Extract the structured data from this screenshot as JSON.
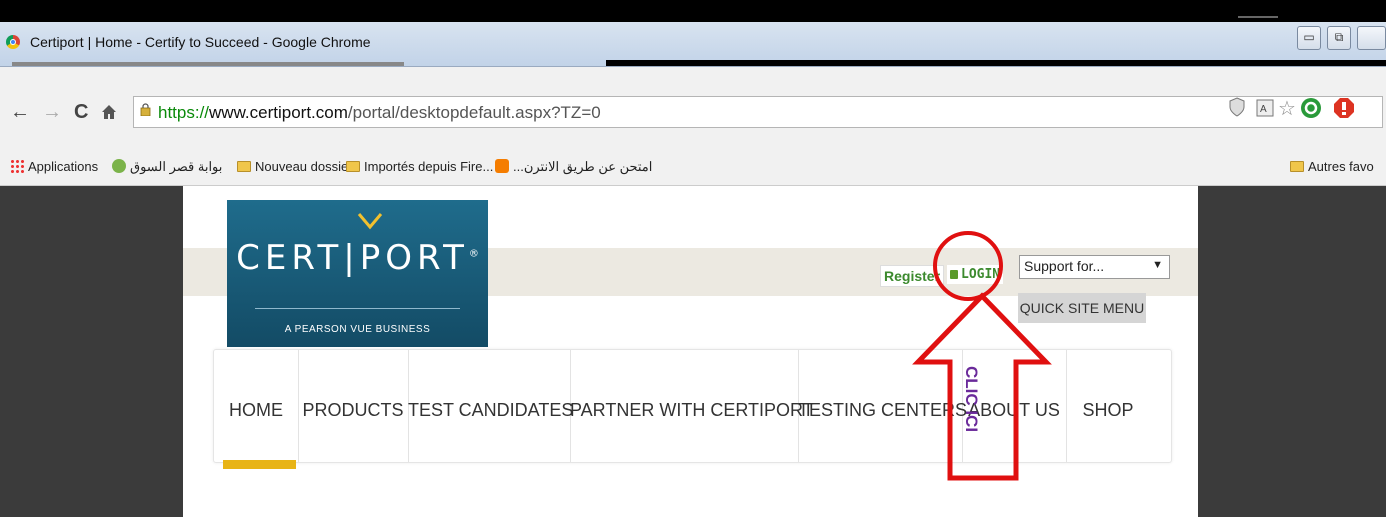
{
  "window": {
    "title": "Certiport | Home - Certify to Succeed - Google Chrome",
    "controls": {
      "minimize": "▭",
      "restore": "⧉"
    }
  },
  "navbar": {
    "url": {
      "scheme": "https://",
      "host": "www.certiport.com",
      "path": "/portal/desktopdefault.aspx?TZ=0"
    },
    "back": "←",
    "forward": "→",
    "reload": "C",
    "home": "🏠"
  },
  "bookmarks": {
    "items": [
      {
        "label": "Applications",
        "icon": "apps-icon"
      },
      {
        "label": "بوابة قصر السوق",
        "icon": "site-icon"
      },
      {
        "label": "Nouveau dossier",
        "icon": "folder-icon"
      },
      {
        "label": "Importés depuis Fire...",
        "icon": "folder-icon"
      },
      {
        "label": "امتحن عن طريق الانترن...",
        "icon": "blogger-icon"
      }
    ],
    "other": {
      "label": "Autres favo",
      "icon": "folder-icon"
    }
  },
  "site": {
    "logo": {
      "name": "CERT|PORT",
      "registered": "®",
      "tagline": "A PEARSON VUE BUSINESS"
    },
    "register": "Register",
    "login": "LOGIN",
    "support_select": {
      "selected": "Support for..."
    },
    "quick_menu": "QUICK SITE MENU",
    "nav": [
      "HOME",
      "PRODUCTS",
      "TEST CANDIDATES",
      "PARTNER WITH CERTIPORT",
      "TESTING CENTERS",
      "ABOUT US",
      "SHOP"
    ]
  },
  "annotation": {
    "label": "CLIC ICI",
    "color": "#e01010",
    "label_color": "#6a2a9a"
  },
  "colors": {
    "logo_bg": "#1a5f7f",
    "link_green": "#3c8a2e",
    "home_underline": "#e8b416",
    "sidebar": "#3b3b3b"
  }
}
